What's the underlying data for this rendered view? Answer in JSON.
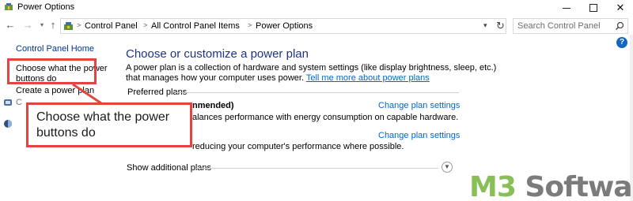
{
  "window": {
    "title": "Power Options",
    "icon": "power-options-icon"
  },
  "address_bar": {
    "crumbs": [
      "Control Panel",
      "All Control Panel Items",
      "Power Options"
    ],
    "search_placeholder": "Search Control Panel"
  },
  "left_panel": {
    "home_link": "Control Panel Home",
    "choose_link_line1": "Choose what the power",
    "choose_link_line2": "buttons do",
    "create_link": "Create a power plan",
    "partial_link": "C"
  },
  "main": {
    "title": "Choose or customize a power plan",
    "desc": "A power plan is a collection of hardware and system settings (like display brightness, sleep, etc.) that manages how your computer uses power.",
    "desc_link": "Tell me more about power plans",
    "preferred_label": "Preferred plans",
    "plan1_name": "nmended)",
    "plan1_change": "Change plan settings",
    "plan1_desc": "alances performance with energy consumption on capable hardware.",
    "plan2_change": "Change plan settings",
    "plan2_desc": "reducing your computer's performance where possible.",
    "show_additional": "Show additional plans"
  },
  "callout": {
    "line1": "Choose what the power",
    "line2": "buttons do"
  },
  "watermark": {
    "part1": "M3",
    "part2": " Software"
  },
  "colors": {
    "highlight": "#e0453f",
    "link": "#0066cc",
    "title": "#1e3287",
    "watermark_green": "#88c057",
    "watermark_gray": "#7b7b7b"
  }
}
